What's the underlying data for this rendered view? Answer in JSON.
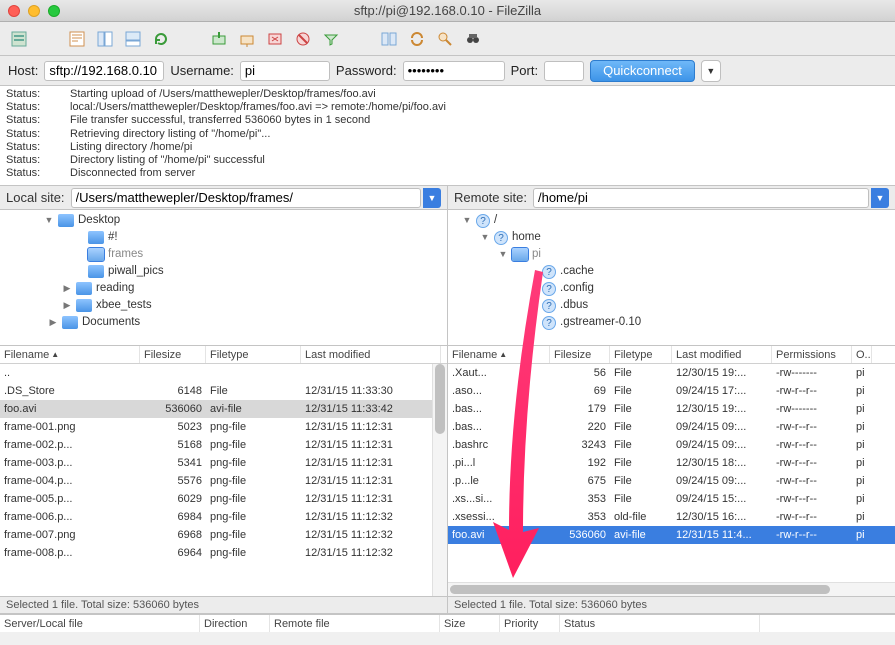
{
  "window": {
    "title": "sftp://pi@192.168.0.10 - FileZilla"
  },
  "quickconnect": {
    "host_label": "Host:",
    "host": "sftp://192.168.0.10",
    "user_label": "Username:",
    "user": "pi",
    "pass_label": "Password:",
    "pass": "••••••••",
    "port_label": "Port:",
    "port": "",
    "button": "Quickconnect"
  },
  "log": [
    {
      "lbl": "Status:",
      "txt": "Starting upload of /Users/matthewepler/Desktop/frames/foo.avi"
    },
    {
      "lbl": "Status:",
      "txt": "local:/Users/matthewepler/Desktop/frames/foo.avi => remote:/home/pi/foo.avi"
    },
    {
      "lbl": "Status:",
      "txt": "File transfer successful, transferred 536060 bytes in 1 second"
    },
    {
      "lbl": "Status:",
      "txt": "Retrieving directory listing of \"/home/pi\"..."
    },
    {
      "lbl": "Status:",
      "txt": "Listing directory /home/pi"
    },
    {
      "lbl": "Status:",
      "txt": "Directory listing of \"/home/pi\" successful"
    },
    {
      "lbl": "Status:",
      "txt": "Disconnected from server"
    }
  ],
  "local": {
    "label": "Local site:",
    "path": "/Users/matthewepler/Desktop/frames/",
    "tree": [
      {
        "indent": 40,
        "disclosure": "▼",
        "icon": "folder-blue",
        "name": "Desktop"
      },
      {
        "indent": 70,
        "disclosure": "",
        "icon": "folder-blue",
        "name": "#!"
      },
      {
        "indent": 70,
        "disclosure": "",
        "icon": "folder-sel",
        "name": "frames",
        "sel": true
      },
      {
        "indent": 70,
        "disclosure": "",
        "icon": "folder-blue",
        "name": "piwall_pics"
      },
      {
        "indent": 58,
        "disclosure": "▶",
        "icon": "folder-blue",
        "name": "reading"
      },
      {
        "indent": 58,
        "disclosure": "▶",
        "icon": "folder-blue",
        "name": "xbee_tests"
      },
      {
        "indent": 44,
        "disclosure": "▶",
        "icon": "folder-blue",
        "name": "Documents"
      }
    ],
    "columns": [
      "Filename",
      "Filesize",
      "Filetype",
      "Last modified"
    ],
    "sortcol": 0,
    "files": [
      {
        "name": "..",
        "size": "",
        "type": "",
        "mod": ""
      },
      {
        "name": ".DS_Store",
        "size": "6148",
        "type": "File",
        "mod": "12/31/15 11:33:30"
      },
      {
        "name": "foo.avi",
        "size": "536060",
        "type": "avi-file",
        "mod": "12/31/15 11:33:42",
        "sel": true
      },
      {
        "name": "frame-001.png",
        "size": "5023",
        "type": "png-file",
        "mod": "12/31/15 11:12:31"
      },
      {
        "name": "frame-002.p...",
        "size": "5168",
        "type": "png-file",
        "mod": "12/31/15 11:12:31"
      },
      {
        "name": "frame-003.p...",
        "size": "5341",
        "type": "png-file",
        "mod": "12/31/15 11:12:31"
      },
      {
        "name": "frame-004.p...",
        "size": "5576",
        "type": "png-file",
        "mod": "12/31/15 11:12:31"
      },
      {
        "name": "frame-005.p...",
        "size": "6029",
        "type": "png-file",
        "mod": "12/31/15 11:12:31"
      },
      {
        "name": "frame-006.p...",
        "size": "6984",
        "type": "png-file",
        "mod": "12/31/15 11:12:32"
      },
      {
        "name": "frame-007.png",
        "size": "6968",
        "type": "png-file",
        "mod": "12/31/15 11:12:32"
      },
      {
        "name": "frame-008.p...",
        "size": "6964",
        "type": "png-file",
        "mod": "12/31/15 11:12:32"
      }
    ],
    "status": "Selected 1 file. Total size: 536060 bytes"
  },
  "remote": {
    "label": "Remote site:",
    "path": "/home/pi",
    "tree": [
      {
        "indent": 10,
        "disclosure": "▼",
        "icon": "folder-q",
        "name": "/"
      },
      {
        "indent": 28,
        "disclosure": "▼",
        "icon": "folder-q",
        "name": "home"
      },
      {
        "indent": 46,
        "disclosure": "▼",
        "icon": "folder-sel",
        "name": "pi",
        "sel": true
      },
      {
        "indent": 76,
        "disclosure": "",
        "icon": "folder-q",
        "name": ".cache"
      },
      {
        "indent": 76,
        "disclosure": "",
        "icon": "folder-q",
        "name": ".config"
      },
      {
        "indent": 76,
        "disclosure": "",
        "icon": "folder-q",
        "name": ".dbus"
      },
      {
        "indent": 76,
        "disclosure": "",
        "icon": "folder-q",
        "name": ".gstreamer-0.10"
      }
    ],
    "columns": [
      "Filename",
      "Filesize",
      "Filetype",
      "Last modified",
      "Permissions",
      "O..."
    ],
    "sortcol": 0,
    "files": [
      {
        "name": ".Xaut...",
        "size": "56",
        "type": "File",
        "mod": "12/30/15 19:...",
        "perm": "-rw-------",
        "own": "pi"
      },
      {
        "name": ".aso...",
        "size": "69",
        "type": "File",
        "mod": "09/24/15 17:...",
        "perm": "-rw-r--r--",
        "own": "pi"
      },
      {
        "name": ".bas...",
        "size": "179",
        "type": "File",
        "mod": "12/30/15 19:...",
        "perm": "-rw-------",
        "own": "pi"
      },
      {
        "name": ".bas...",
        "size": "220",
        "type": "File",
        "mod": "09/24/15 09:...",
        "perm": "-rw-r--r--",
        "own": "pi"
      },
      {
        "name": ".bashrc",
        "size": "3243",
        "type": "File",
        "mod": "09/24/15 09:...",
        "perm": "-rw-r--r--",
        "own": "pi"
      },
      {
        "name": ".pi...l",
        "size": "192",
        "type": "File",
        "mod": "12/30/15 18:...",
        "perm": "-rw-r--r--",
        "own": "pi"
      },
      {
        "name": ".p...le",
        "size": "675",
        "type": "File",
        "mod": "09/24/15 09:...",
        "perm": "-rw-r--r--",
        "own": "pi"
      },
      {
        "name": ".xs...si...",
        "size": "353",
        "type": "File",
        "mod": "09/24/15 15:...",
        "perm": "-rw-r--r--",
        "own": "pi"
      },
      {
        "name": ".xsessi...",
        "size": "353",
        "type": "old-file",
        "mod": "12/30/15 16:...",
        "perm": "-rw-r--r--",
        "own": "pi"
      },
      {
        "name": "foo.avi",
        "size": "536060",
        "type": "avi-file",
        "mod": "12/31/15 11:4...",
        "perm": "-rw-r--r--",
        "own": "pi",
        "selblue": true
      }
    ],
    "status": "Selected 1 file. Total size: 536060 bytes"
  },
  "queue_columns": [
    "Server/Local file",
    "Direction",
    "Remote file",
    "Size",
    "Priority",
    "Status"
  ]
}
